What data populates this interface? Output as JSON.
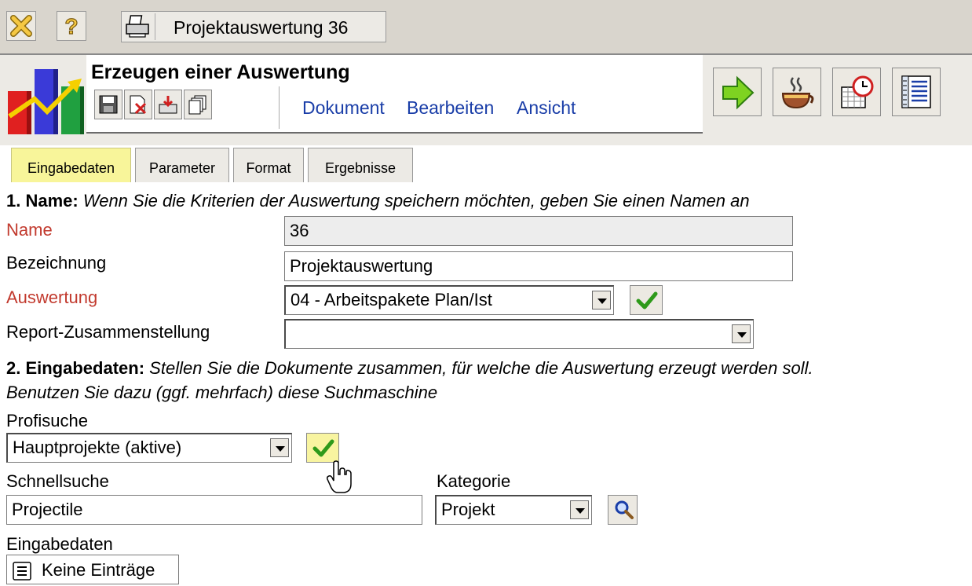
{
  "window": {
    "document_tab_title": "Projektauswertung 36"
  },
  "header": {
    "title": "Erzeugen einer Auswertung",
    "menu": [
      "Dokument",
      "Bearbeiten",
      "Ansicht"
    ]
  },
  "tabs": [
    {
      "label": "Eingabedaten",
      "active": true
    },
    {
      "label": "Parameter",
      "active": false
    },
    {
      "label": "Format",
      "active": false
    },
    {
      "label": "Ergebnisse",
      "active": false
    }
  ],
  "section1": {
    "heading_bold": "1. Name:",
    "heading_text": "Wenn Sie die Kriterien der Auswertung speichern möchten, geben Sie einen Namen an",
    "name_label": "Name",
    "name_value": "36",
    "bezeichnung_label": "Bezeichnung",
    "bezeichnung_value": "Projektauswertung",
    "auswertung_label": "Auswertung",
    "auswertung_value": "04 - Arbeitspakete Plan/Ist",
    "report_label": "Report-Zusammenstellung",
    "report_value": ""
  },
  "section2": {
    "heading_bold": "2. Eingabedaten:",
    "heading_text_line1": "Stellen Sie die Dokumente zusammen, für welche die Auswertung erzeugt werden soll.",
    "heading_text_line2": "Benutzen Sie dazu (ggf. mehrfach) diese Suchmaschine",
    "profisuche_label": "Profisuche",
    "profisuche_value": "Hauptprojekte (aktive)",
    "schnellsuche_label": "Schnellsuche",
    "schnellsuche_value": "Projectile",
    "kategorie_label": "Kategorie",
    "kategorie_value": "Projekt",
    "eingabedaten_label": "Eingabedaten",
    "entries_label": "Keine Einträge"
  },
  "colors": {
    "required_label": "#c23a2e",
    "menu_link": "#1a3ea8",
    "active_tab": "#f8f59a",
    "toolbar_bg": "#d9d5cd"
  },
  "icons": {
    "top_toolbar": [
      "close-icon",
      "help-icon",
      "print-icon"
    ],
    "header_actions": [
      "save-icon",
      "delete-icon",
      "import-icon",
      "copy-icon"
    ],
    "header_big": [
      "go-arrow-icon",
      "coffee-break-icon",
      "calendar-clock-icon",
      "report-layout-icon"
    ],
    "logo": "chart-logo-icon"
  }
}
